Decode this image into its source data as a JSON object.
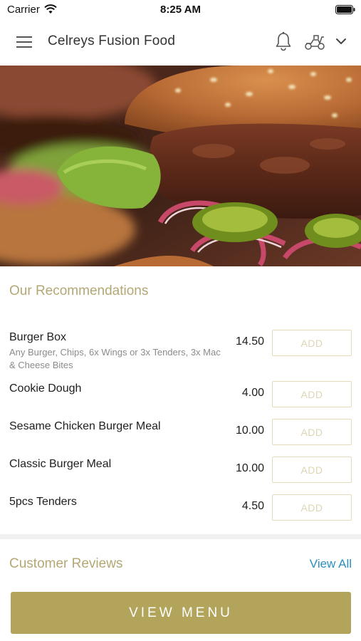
{
  "status_bar": {
    "carrier": "Carrier",
    "time": "8:25 AM"
  },
  "header": {
    "title": "Celreys Fusion Food",
    "icons": [
      "menu-icon",
      "bell-icon",
      "scooter-icon",
      "chevron-down-icon"
    ]
  },
  "hero": {
    "subject": "burger"
  },
  "recommendations": {
    "title": "Our Recommendations",
    "add_label": "ADD",
    "items": [
      {
        "name": "Burger Box",
        "description": "Any Burger, Chips, 6x Wings or 3x Tenders, 3x Mac & Cheese Bites",
        "price": "14.50"
      },
      {
        "name": "Cookie Dough",
        "description": "",
        "price": "4.00"
      },
      {
        "name": "Sesame Chicken Burger Meal",
        "description": "",
        "price": "10.00"
      },
      {
        "name": "Classic Burger Meal",
        "description": "",
        "price": "10.00"
      },
      {
        "name": "5pcs Tenders",
        "description": "",
        "price": "4.50"
      }
    ]
  },
  "reviews": {
    "title": "Customer Reviews",
    "view_all": "View All"
  },
  "footer": {
    "view_menu": "VIEW MENU"
  },
  "colors": {
    "accent": "#b2a45a",
    "section_title": "#b3a874",
    "link": "#2b8fbe",
    "add_border": "#e3dcba"
  }
}
